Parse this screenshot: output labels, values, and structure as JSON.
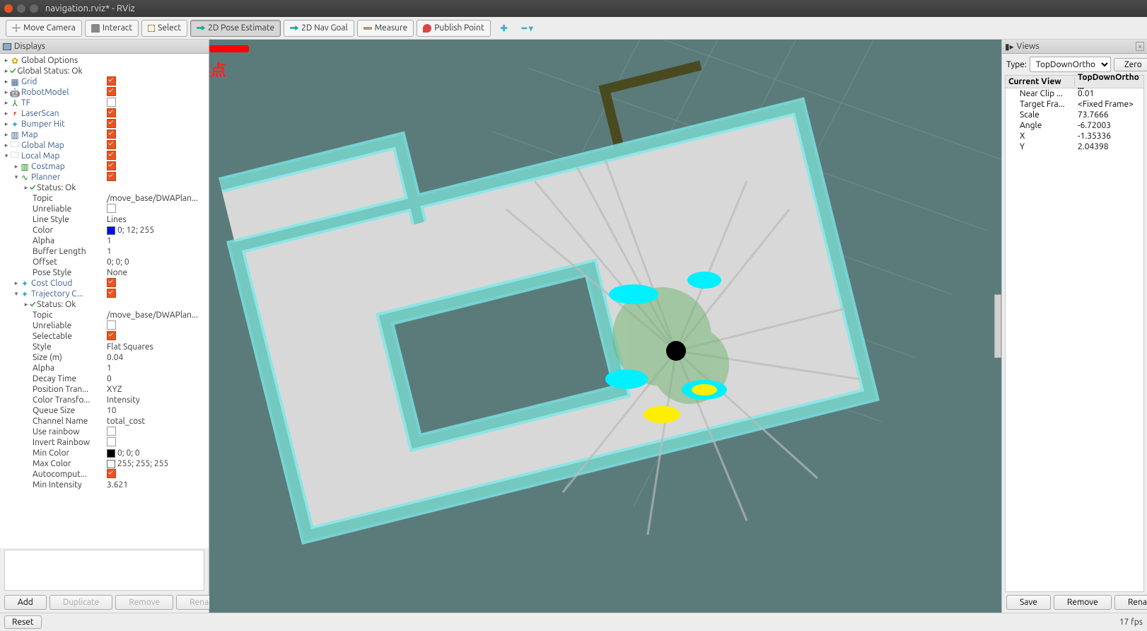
{
  "window": {
    "title": "navigation.rviz* - RViz"
  },
  "toolbar": {
    "move_camera": "Move Camera",
    "interact": "Interact",
    "select": "Select",
    "pose_estimate": "2D Pose Estimate",
    "nav_goal": "2D Nav Goal",
    "measure": "Measure",
    "publish_point": "Publish Point"
  },
  "displays_panel": {
    "title": "Displays",
    "root": {
      "global_options": "Global Options",
      "global_status": "Global Status: Ok",
      "grid": "Grid",
      "robot_model": "RobotModel",
      "tf": "TF",
      "laser_scan": "LaserScan",
      "bumper_hit": "Bumper Hit",
      "map": "Map",
      "global_map": "Global Map",
      "local_map": "Local Map"
    },
    "local_map": {
      "costmap": "Costmap",
      "planner": {
        "label": "Planner",
        "status": "Status: Ok",
        "props": {
          "topic": {
            "k": "Topic",
            "v": "/move_base/DWAPlan..."
          },
          "unreliable": {
            "k": "Unreliable"
          },
          "line_style": {
            "k": "Line Style",
            "v": "Lines"
          },
          "color": {
            "k": "Color",
            "v": "0; 12; 255",
            "swatch": "#000cff"
          },
          "alpha": {
            "k": "Alpha",
            "v": "1"
          },
          "buffer_length": {
            "k": "Buffer Length",
            "v": "1"
          },
          "offset": {
            "k": "Offset",
            "v": "0; 0; 0"
          },
          "pose_style": {
            "k": "Pose Style",
            "v": "None"
          }
        }
      },
      "cost_cloud": "Cost Cloud",
      "trajectory": {
        "label": "Trajectory C...",
        "status": "Status: Ok",
        "props": {
          "topic": {
            "k": "Topic",
            "v": "/move_base/DWAPlan..."
          },
          "unreliable": {
            "k": "Unreliable"
          },
          "selectable": {
            "k": "Selectable"
          },
          "style": {
            "k": "Style",
            "v": "Flat Squares"
          },
          "size": {
            "k": "Size (m)",
            "v": "0.04"
          },
          "alpha": {
            "k": "Alpha",
            "v": "1"
          },
          "decay": {
            "k": "Decay Time",
            "v": "0"
          },
          "pos_trans": {
            "k": "Position Tran...",
            "v": "XYZ"
          },
          "color_trans": {
            "k": "Color Transfo...",
            "v": "Intensity"
          },
          "queue": {
            "k": "Queue Size",
            "v": "10"
          },
          "channel": {
            "k": "Channel Name",
            "v": "total_cost"
          },
          "use_rainbow": {
            "k": "Use rainbow"
          },
          "invert_rainbow": {
            "k": "Invert Rainbow"
          },
          "min_color": {
            "k": "Min Color",
            "v": "0; 0; 0",
            "swatch": "#000000"
          },
          "max_color": {
            "k": "Max Color",
            "v": "255; 255; 255",
            "swatch": "#ffffff"
          },
          "autocompute": {
            "k": "Autocomput..."
          },
          "min_intensity": {
            "k": "Min Intensity",
            "v": "3.621"
          }
        }
      }
    },
    "buttons": {
      "add": "Add",
      "duplicate": "Duplicate",
      "remove": "Remove",
      "rename": "Rename"
    }
  },
  "views_panel": {
    "title": "Views",
    "type_label": "Type:",
    "type_value": "TopDownOrtho",
    "zero": "Zero",
    "header": {
      "name": "Current View",
      "value": "TopDownOrtho ..."
    },
    "rows": {
      "near_clip": {
        "k": "Near Clip ...",
        "v": "0.01"
      },
      "target_frame": {
        "k": "Target Fra...",
        "v": "<Fixed Frame>"
      },
      "scale": {
        "k": "Scale",
        "v": "73.7666"
      },
      "angle": {
        "k": "Angle",
        "v": "-6.72003"
      },
      "x": {
        "k": "X",
        "v": "-1.35336"
      },
      "y": {
        "k": "Y",
        "v": "2.04398"
      }
    },
    "buttons": {
      "save": "Save",
      "remove": "Remove",
      "rename": "Rename"
    }
  },
  "statusbar": {
    "reset": "Reset",
    "fps": "17 fps"
  },
  "annotation": {
    "text": "设置起点"
  }
}
